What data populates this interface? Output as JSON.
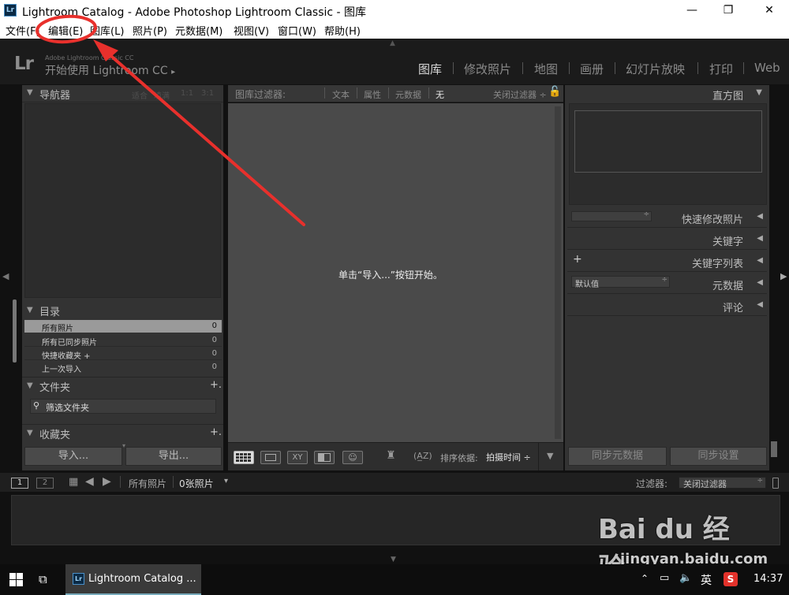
{
  "window": {
    "title": "Lightroom Catalog - Adobe Photoshop Lightroom Classic - 图库",
    "app_icon": "Lr",
    "minimize": "—",
    "maximize": "❐",
    "close": "✕"
  },
  "menu": {
    "items": [
      "文件(F)",
      "编辑(E)",
      "图库(L)",
      "照片(P)",
      "元数据(M)",
      "视图(V)",
      "窗口(W)",
      "帮助(H)"
    ]
  },
  "identity": {
    "logo": "Lr",
    "small": "Adobe Lightroom Classic CC",
    "big": "开始使用 Lightroom CC",
    "arrow": "▸"
  },
  "modules": [
    "图库",
    "修改照片",
    "地图",
    "画册",
    "幻灯片放映",
    "打印",
    "Web"
  ],
  "navigator": {
    "title": "导航器",
    "zoom": [
      "适合",
      "填满",
      "1:1",
      "3:1"
    ]
  },
  "catalog": {
    "title": "目录",
    "items": [
      {
        "label": "所有照片",
        "count": "0"
      },
      {
        "label": "所有已同步照片",
        "count": "0"
      },
      {
        "label": "快捷收藏夹 +",
        "count": "0"
      },
      {
        "label": "上一次导入",
        "count": "0"
      }
    ]
  },
  "folders": {
    "title": "文件夹",
    "plus": "+.",
    "filter_placeholder": "筛选文件夹"
  },
  "collections": {
    "title": "收藏夹",
    "plus": "+."
  },
  "left_buttons": {
    "import": "导入...",
    "export": "导出..."
  },
  "filter_bar": {
    "label": "图库过滤器:",
    "options": [
      "文本",
      "属性",
      "元数据",
      "无"
    ],
    "preset": "关闭过滤器 ÷"
  },
  "center": {
    "message": "单击“导入...”按钮开始。"
  },
  "toolbar": {
    "sort_label": "排序依据:",
    "sort_value": "拍摄时间 ÷",
    "sort_icon": "(A̲Z)",
    "xy": "XY"
  },
  "right": {
    "histogram": "直方图",
    "quick_develop": "快速修改照片",
    "keywording": "关键字",
    "keyword_list": "关键字列表",
    "plus": "+",
    "metadata": "元数据",
    "metadata_preset": "默认值",
    "comments": "评论",
    "sync_metadata": "同步元数据",
    "sync_settings": "同步设置"
  },
  "filmstrip": {
    "page1": "1",
    "page2": "2",
    "source": "所有照片",
    "count": "0张照片",
    "filter_label": "过滤器:",
    "filter_value": "关闭过滤器"
  },
  "taskbar": {
    "app_label": "Lightroom Catalog ...",
    "ime": "英",
    "clock": "14:37",
    "sogou": "S"
  },
  "watermark": {
    "text": "Bai du 经验",
    "url": "jingyan.baidu.com"
  },
  "colors": {
    "accent_annotation": "#e8302c",
    "panel": "#333333",
    "background": "#1b1b1b"
  }
}
